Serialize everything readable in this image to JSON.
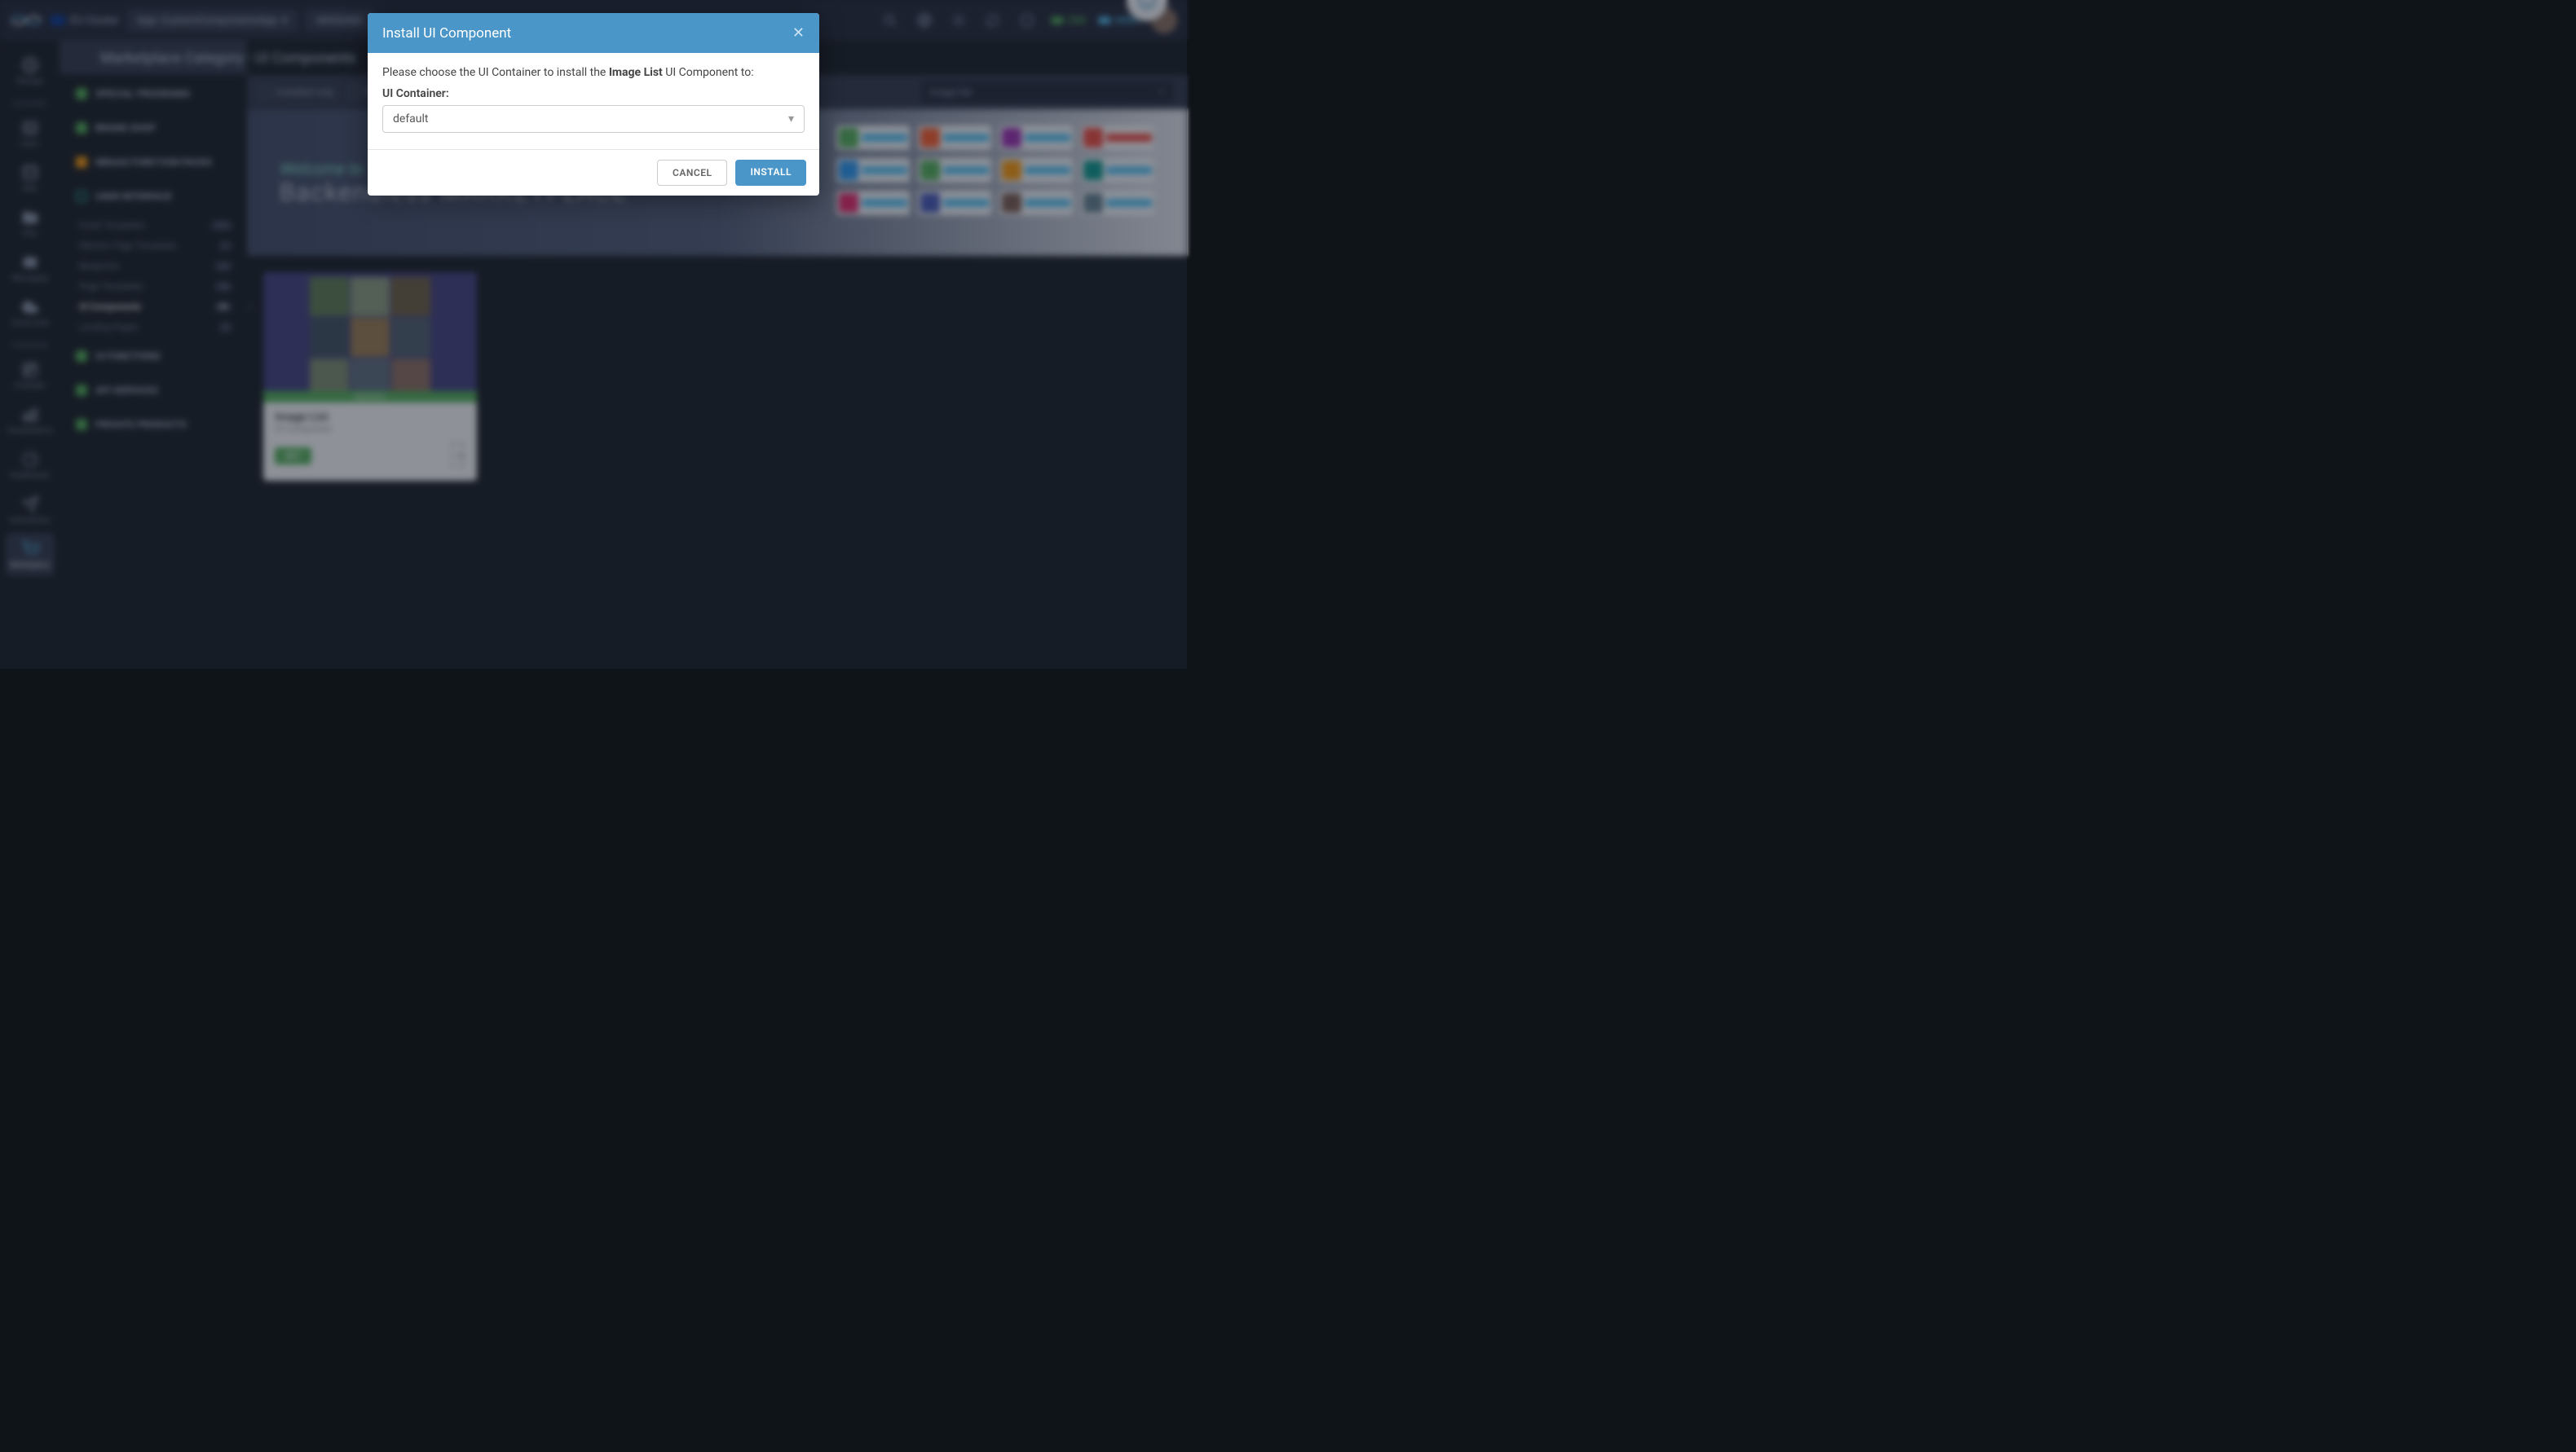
{
  "topbar": {
    "cluster": "EU Cluster",
    "app_label": "App: CustomComponentsApp",
    "mission": "MISSIONS",
    "credits_green": "200",
    "credits_blue": "6450"
  },
  "leftSidebar": {
    "section_backend": "BACKEND",
    "section_frontend": "FRONTEND",
    "items": [
      {
        "label": "Manage"
      },
      {
        "label": "Users"
      },
      {
        "label": "Data"
      },
      {
        "label": "Files"
      },
      {
        "label": "Messaging"
      },
      {
        "label": "Cloud Code"
      },
      {
        "label": "UI Builder"
      },
      {
        "label": "Visualizations"
      },
      {
        "label": "Dashboards"
      },
      {
        "label": "Automations"
      },
      {
        "label": "Marketplace"
      }
    ]
  },
  "categories": {
    "special_programs": "SPECIAL PROGRAMS",
    "brand_shop": "BRAND SHOP",
    "mbaas": "MBAAS FUNCTION PACKS",
    "user_interface": "USER INTERFACE",
    "ui_functions": "UI FUNCTIONS",
    "api_services": "API SERVICES",
    "private_products": "PRIVATE PRODUCTS",
    "subs": [
      {
        "label": "Email Templates",
        "count": "130"
      },
      {
        "label": "Mission Page Templates",
        "count": "1"
      },
      {
        "label": "Blueprints",
        "count": "23"
      },
      {
        "label": "Page Templates",
        "count": "38"
      },
      {
        "label": "UI Components",
        "count": "96"
      },
      {
        "label": "Landing Pages",
        "count": "4"
      }
    ]
  },
  "breadcrumb": "Marketplace Category - UI Components",
  "filters": {
    "installed_only": "Installed only",
    "free_only": "Free only",
    "search_value": "image list"
  },
  "hero": {
    "welcome": "Welcome to",
    "title": "Backendless MARKETPLACE"
  },
  "card": {
    "title": "Image List",
    "subtitle": "UI Component",
    "get": "GET",
    "app_label": "Application",
    "stats": {
      "downloads": "8",
      "installs": "0",
      "stars": "0"
    }
  },
  "modal": {
    "title": "Install UI Component",
    "prompt_pre": "Please choose the UI Container to install the ",
    "prompt_name": "Image List",
    "prompt_post": " UI Component to:",
    "container_label": "UI Container:",
    "selected": "default",
    "cancel": "CANCEL",
    "install": "INSTALL"
  }
}
